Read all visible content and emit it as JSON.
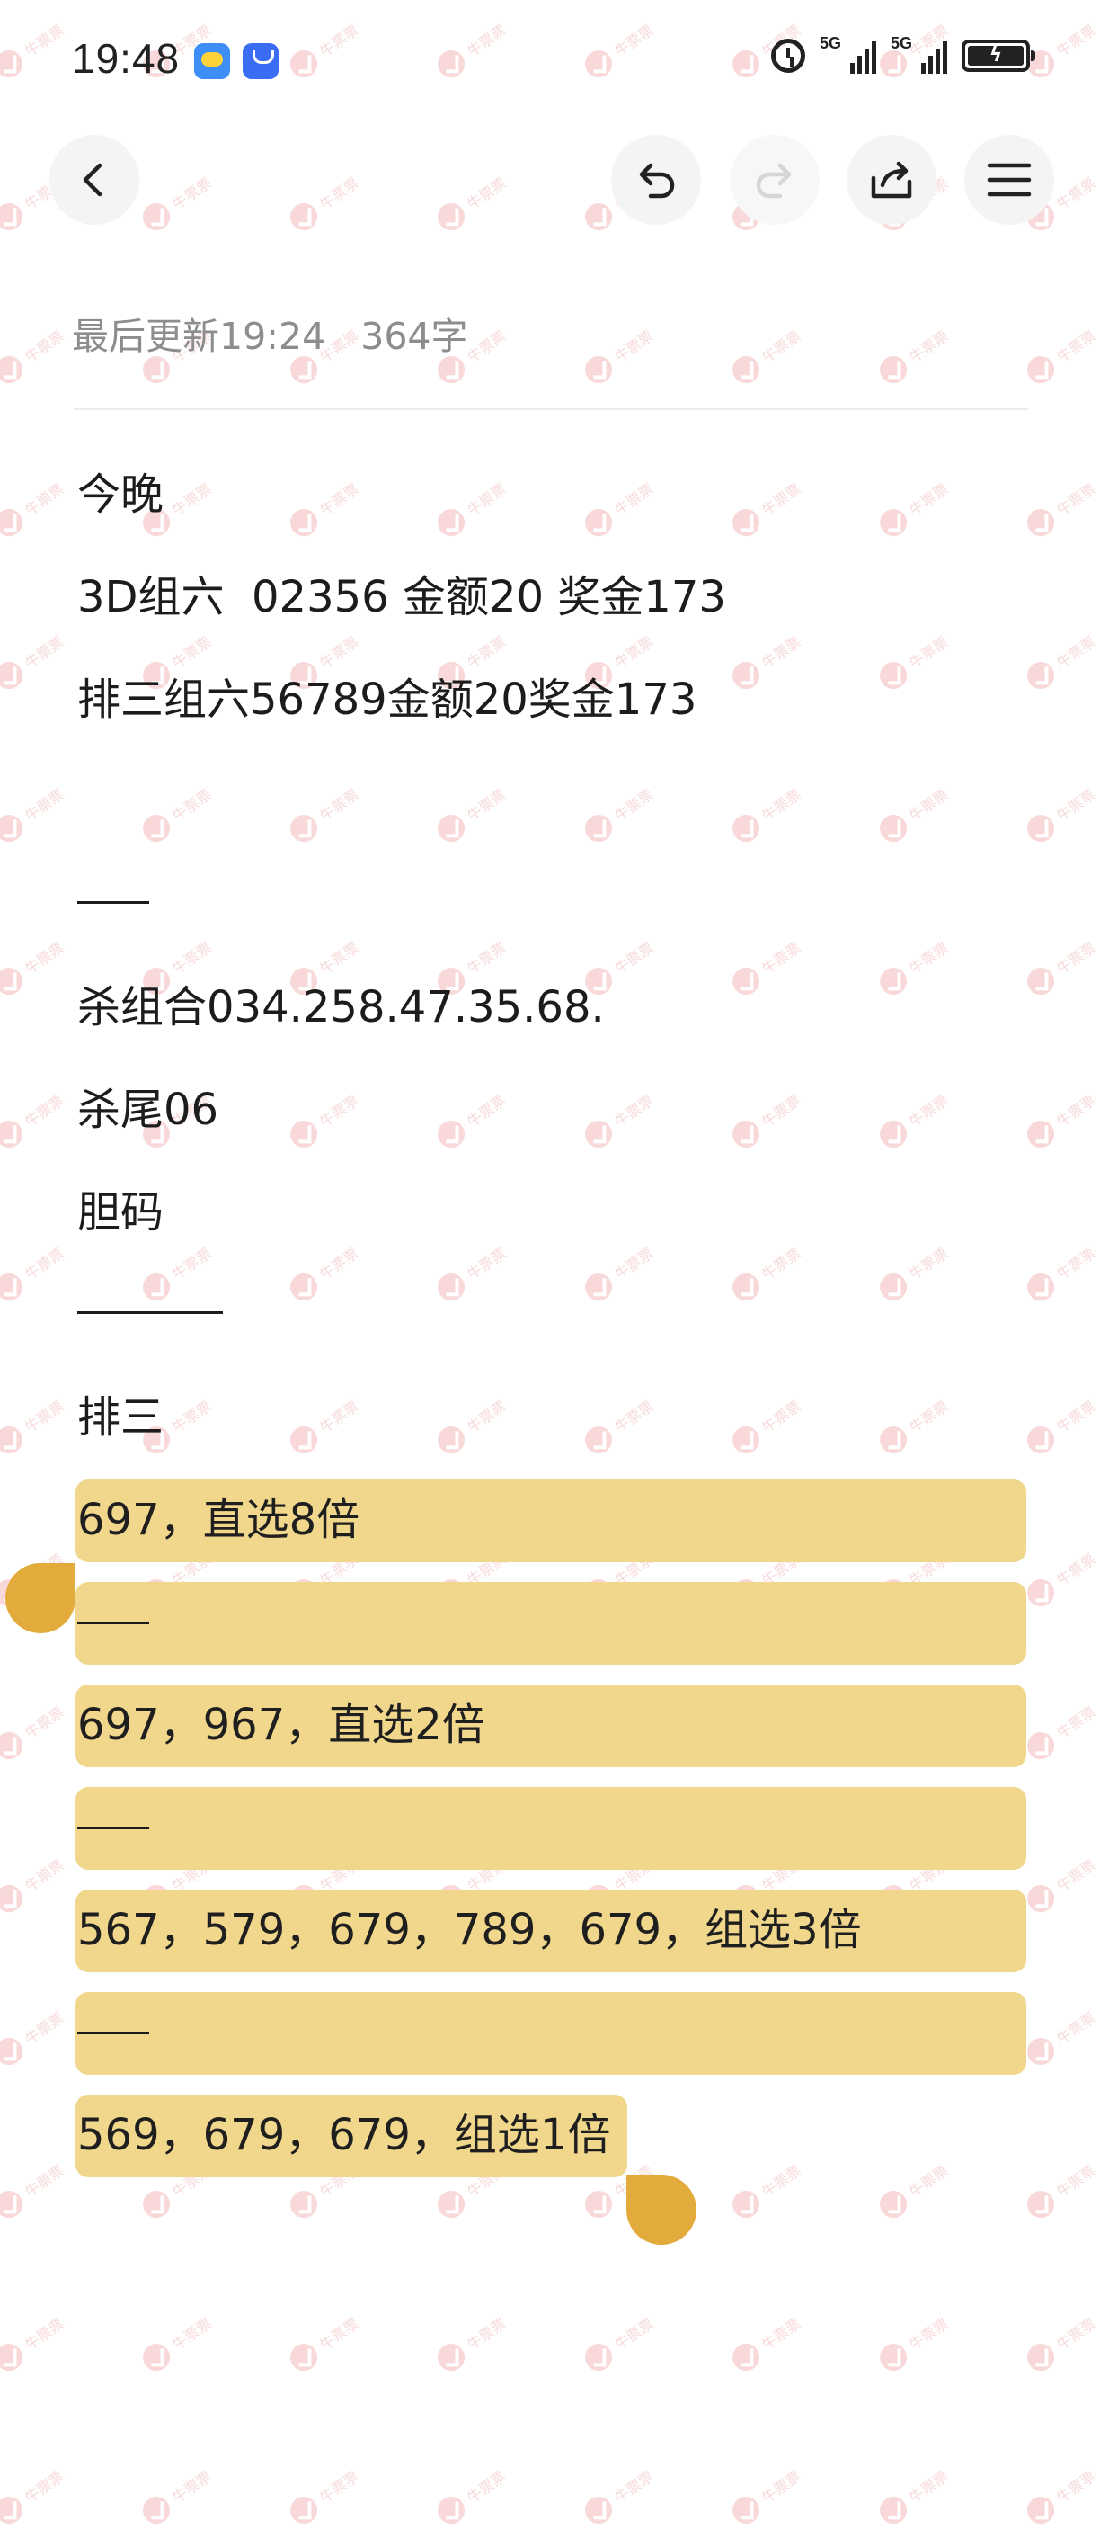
{
  "status_bar": {
    "time": "19:48",
    "network_1": "5G",
    "network_2": "5G",
    "battery_charging_icon": "bolt-icon"
  },
  "toolbar": {
    "back_icon": "chevron-left-icon",
    "undo_icon": "undo-icon",
    "redo_icon": "redo-icon",
    "share_icon": "share-icon",
    "menu_icon": "hamburger-menu-icon"
  },
  "note": {
    "meta": "最后更新19:24   364字",
    "lines": {
      "l1": "今晚",
      "l2": "3D组六  02356 金额20 奖金173",
      "l3": "排三组六56789金额20奖金173",
      "l5": "杀组合034.258.47.35.68.",
      "l6": "杀尾06",
      "l7": "胆码",
      "l9": "排三"
    },
    "highlighted": {
      "h1": "697，直选8倍",
      "h3": "697，967，直选2倍",
      "h5": "567，579，679，789，679，组选3倍",
      "h7": "569，679，679，组选1倍"
    }
  },
  "watermark": {
    "text": "牛票票"
  },
  "colors": {
    "highlight": "#f0d78c",
    "selection_handle": "#e2ab3b",
    "meta_text": "#8d8d8d",
    "watermark": "#f1bcbc"
  }
}
